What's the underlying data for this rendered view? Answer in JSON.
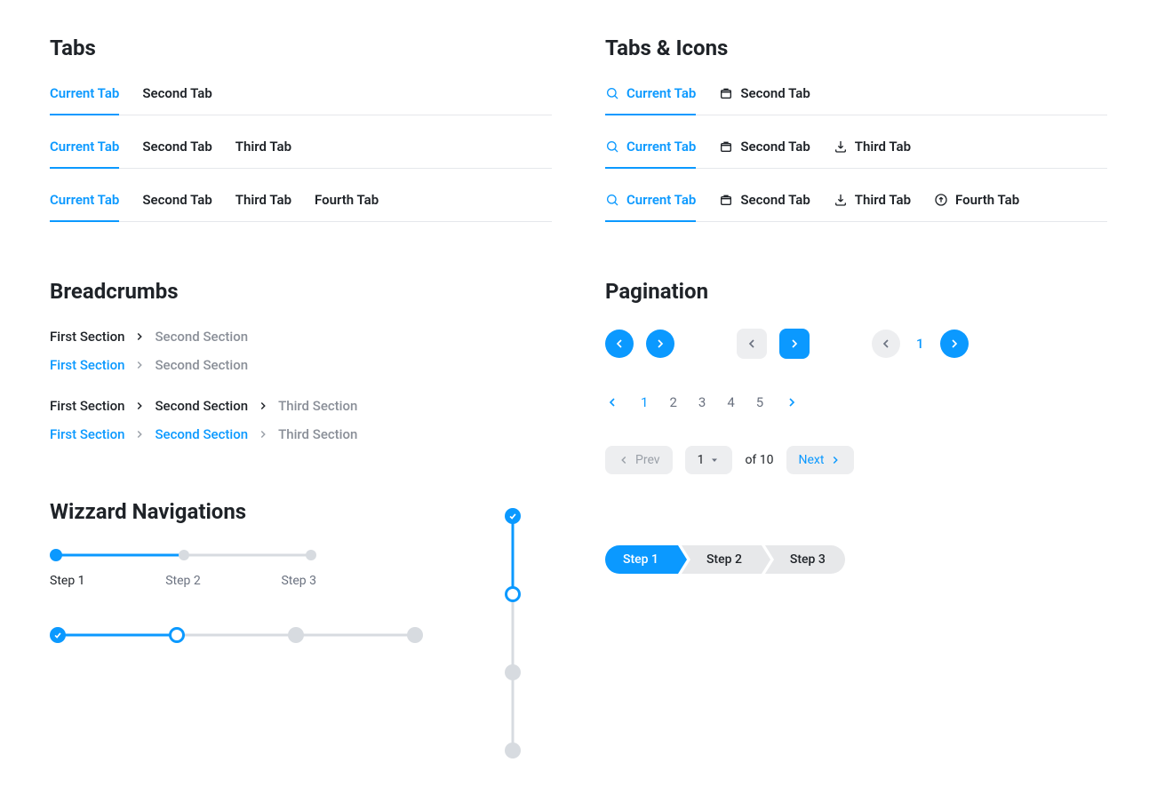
{
  "sections": {
    "tabs": "Tabs",
    "tabs_icons": "Tabs & Icons",
    "breadcrumbs": "Breadcrumbs",
    "pagination": "Pagination",
    "wizard": "Wizzard Navigations"
  },
  "tabs": {
    "current": "Current Tab",
    "second": "Second Tab",
    "third": "Third Tab",
    "fourth": "Fourth Tab"
  },
  "crumbs": {
    "first": "First Section",
    "second": "Second Section",
    "third": "Third  Section"
  },
  "wizard_steps": {
    "s1": "Step 1",
    "s2": "Step 2",
    "s3": "Step 3"
  },
  "pagination": {
    "p1": "1",
    "p2": "2",
    "p3": "3",
    "p4": "4",
    "p5": "5",
    "prev": "Prev",
    "next": "Next",
    "page_value": "1",
    "of_total": "of 10"
  }
}
